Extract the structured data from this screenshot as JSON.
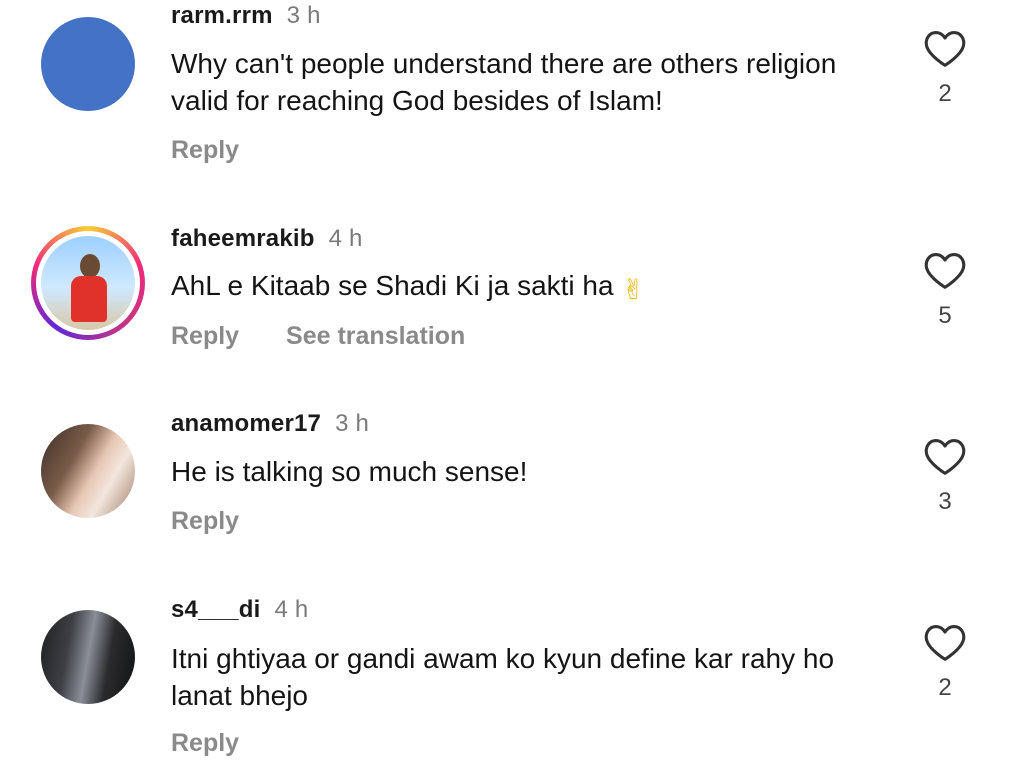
{
  "comments": [
    {
      "username": "rarm.rrm",
      "time": "3 h",
      "text": "Why can't people understand there are others religion valid for reaching God besides of Islam!",
      "reply_label": "Reply",
      "likes": "2"
    },
    {
      "username": "faheemrakib",
      "time": "4 h",
      "text": "AhL e Kitaab se Shadi Ki ja sakti ha",
      "emoji": "✌",
      "reply_label": "Reply",
      "see_translation_label": "See translation",
      "likes": "5"
    },
    {
      "username": "anamomer17",
      "time": "3 h",
      "text": "He is talking so much sense!",
      "reply_label": "Reply",
      "likes": "3"
    },
    {
      "username": "s4___di",
      "time": "4 h",
      "text": "Itni ghtiyaa or gandi awam ko kyun define kar rahy ho lanat bhejo",
      "reply_label": "Reply",
      "likes": "2"
    }
  ],
  "icons": {
    "like": "heart-outline-icon"
  },
  "colors": {
    "avatar_blue": "#4472c4",
    "muted_text": "#8a8a8a"
  }
}
